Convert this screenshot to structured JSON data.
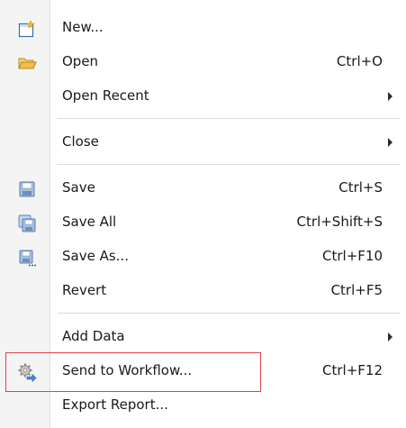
{
  "menu": {
    "items": [
      {
        "label": "New...",
        "shortcut": "",
        "icon": "new-file-icon",
        "submenu": false
      },
      {
        "label": "Open",
        "shortcut": "Ctrl+O",
        "icon": "open-folder-icon",
        "submenu": false
      },
      {
        "label": "Open Recent",
        "shortcut": "",
        "icon": "",
        "submenu": true
      },
      {
        "label": "Close",
        "shortcut": "",
        "icon": "",
        "submenu": true
      },
      {
        "label": "Save",
        "shortcut": "Ctrl+S",
        "icon": "save-disk-icon",
        "submenu": false
      },
      {
        "label": "Save All",
        "shortcut": "Ctrl+Shift+S",
        "icon": "save-all-disks-icon",
        "submenu": false
      },
      {
        "label": "Save As...",
        "shortcut": "Ctrl+F10",
        "icon": "save-as-disk-icon",
        "submenu": false
      },
      {
        "label": "Revert",
        "shortcut": "Ctrl+F5",
        "icon": "",
        "submenu": false
      },
      {
        "label": "Add Data",
        "shortcut": "",
        "icon": "",
        "submenu": true
      },
      {
        "label": "Send to Workflow...",
        "shortcut": "Ctrl+F12",
        "icon": "workflow-gears-icon",
        "submenu": false
      },
      {
        "label": "Export Report...",
        "shortcut": "",
        "icon": "",
        "submenu": false
      }
    ]
  },
  "colors": {
    "gutter": "#f4f4f4",
    "separator": "#dcdcdc",
    "highlight_border": "#e0424b",
    "folder": "#e7b648",
    "disk": "#5a7fb8"
  }
}
